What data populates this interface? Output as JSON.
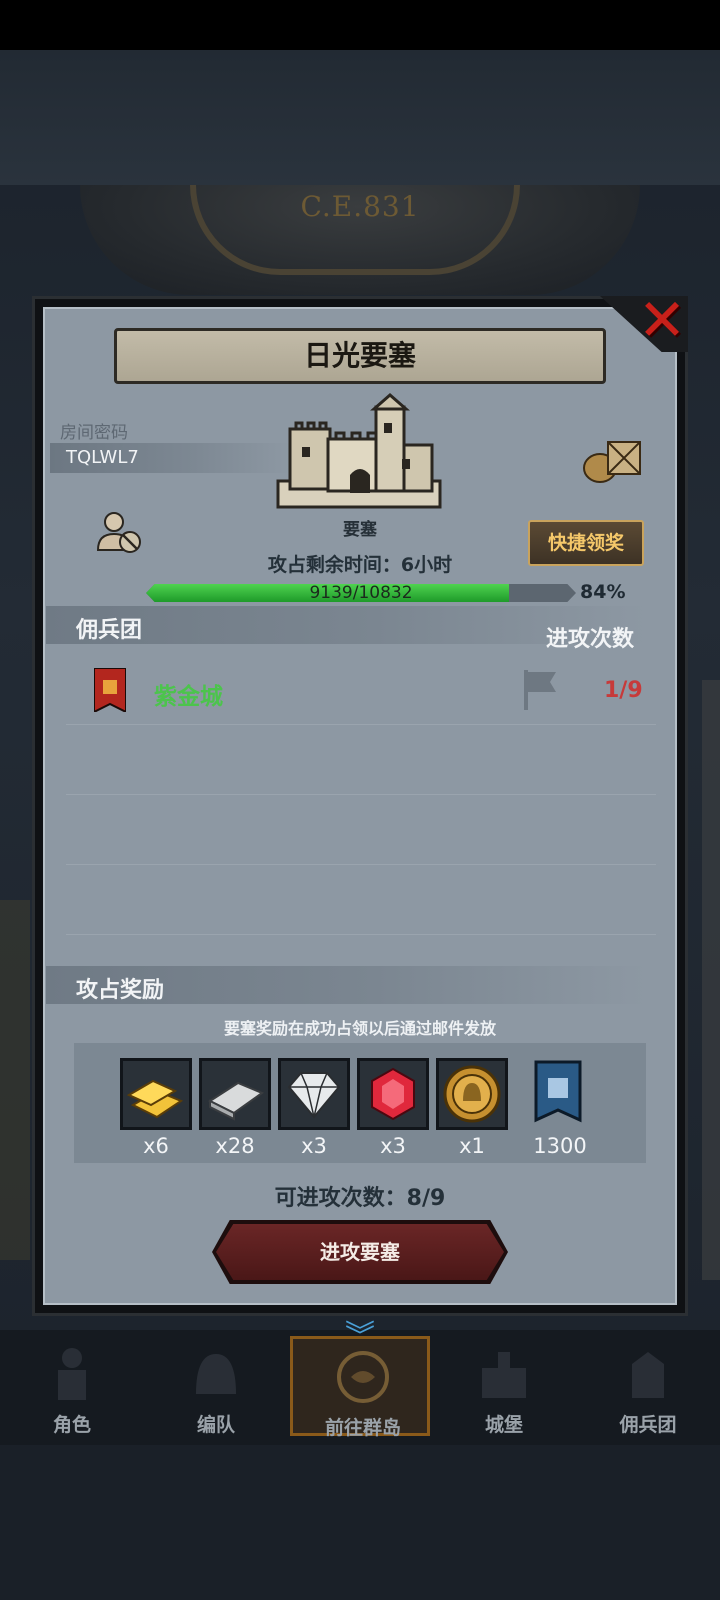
{
  "background": {
    "era_text": "C.E.831"
  },
  "dialog": {
    "title": "日光要塞",
    "close_icon": "close-x-icon",
    "room": {
      "label": "房间密码",
      "code": "TQLWL7"
    },
    "fortress": {
      "label": "要塞",
      "icon": "castle-icon"
    },
    "quick_claim_label": "快捷领奖",
    "timer_text": "攻占剩余时间：6小时",
    "progress": {
      "current": 9139,
      "total": 10832,
      "text": "9139/10832",
      "percent_text": "84%"
    },
    "mercenary": {
      "header_label": "佣兵团",
      "attack_count_label": "进攻次数",
      "rows": [
        {
          "name": "紫金城",
          "count": "1/9"
        }
      ]
    },
    "rewards": {
      "header_label": "攻占奖励",
      "note": "要塞奖励在成功占领以后通过邮件发放",
      "items": [
        {
          "icon": "gold-bar-icon",
          "qty": "x6"
        },
        {
          "icon": "silver-bar-icon",
          "qty": "x28"
        },
        {
          "icon": "diamond-icon",
          "qty": "x3"
        },
        {
          "icon": "ruby-icon",
          "qty": "x3"
        },
        {
          "icon": "knight-medal-icon",
          "qty": "x1"
        },
        {
          "icon": "guild-banner-icon",
          "qty": "1300"
        }
      ]
    },
    "attempts_text": "可进攻次数：8/9",
    "attack_button_label": "进攻要塞"
  },
  "nav": {
    "items": [
      {
        "label": "角色",
        "icon": "knight-icon"
      },
      {
        "label": "编队",
        "icon": "helmet-icon"
      },
      {
        "label": "前往群岛",
        "icon": "compass-map-icon",
        "active": true
      },
      {
        "label": "城堡",
        "icon": "castle-icon"
      },
      {
        "label": "佣兵团",
        "icon": "mercenary-icon"
      }
    ]
  },
  "colors": {
    "accent_gold": "#c9a35c",
    "green": "#4cc44c",
    "red": "#c73a3a",
    "panel": "#8d98a3"
  }
}
